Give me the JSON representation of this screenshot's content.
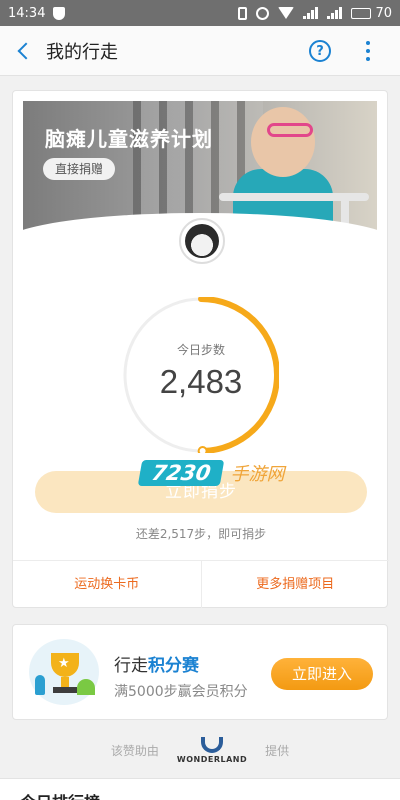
{
  "status_bar": {
    "time": "14:34",
    "battery": "70",
    "network_1": "4G",
    "network_2": "3G"
  },
  "app_bar": {
    "title": "我的行走",
    "help_label": "?"
  },
  "charity": {
    "title": "脑瘫儿童滋养计划",
    "donate_label": "直接捐赠"
  },
  "steps": {
    "label": "今日步数",
    "value": "2,483",
    "progress": 0.4966,
    "cta_label": "立即捐步",
    "hint": "还差2,517步，即可捐步"
  },
  "card_links": {
    "left": "运动换卡币",
    "right": "更多捐赠项目"
  },
  "points": {
    "title_prefix": "行走",
    "title_highlight": "积分赛",
    "subtitle": "满5000步赢会员积分",
    "enter_label": "立即进入"
  },
  "provider": {
    "prefix": "该赞助由",
    "brand": "WONDERLAND",
    "suffix": "提供"
  },
  "bottom_section": {
    "title": "今日排行榜"
  },
  "watermark": {
    "brand_number": "7230",
    "brand_text": "手游网"
  },
  "colors": {
    "accent_blue": "#1b82d2",
    "accent_orange": "#f6a91a",
    "link_orange": "#ec6a1e"
  },
  "icons": {
    "back": "back-arrow-icon",
    "help": "help-circle-icon",
    "more": "more-vertical-icon"
  }
}
